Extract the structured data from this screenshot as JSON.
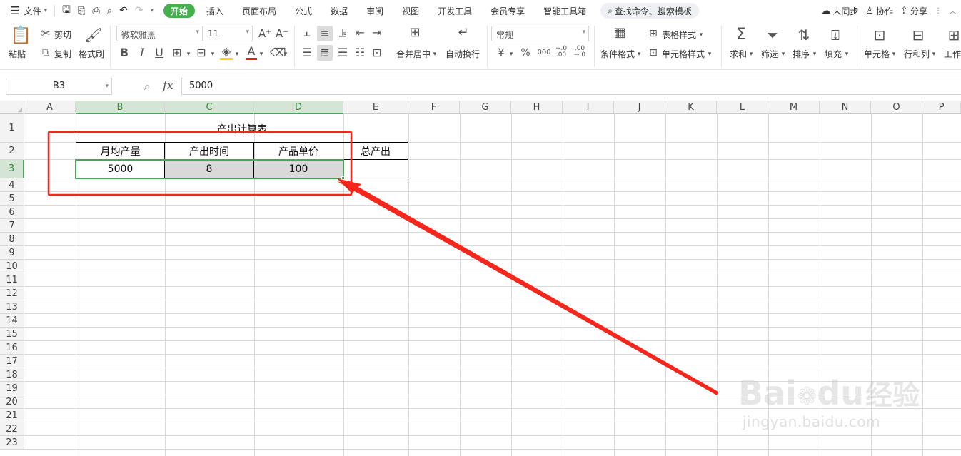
{
  "menu": {
    "file_label": "文件",
    "tabs": [
      "开始",
      "插入",
      "页面布局",
      "公式",
      "数据",
      "审阅",
      "视图",
      "开发工具",
      "会员专享",
      "智能工具箱"
    ],
    "search_label": "查找命令、搜索模板",
    "sync_label": "未同步",
    "collab_label": "协作",
    "share_label": "分享"
  },
  "ribbon": {
    "paste": "粘贴",
    "cut": "剪切",
    "copy": "复制",
    "format_painter": "格式刷",
    "font_name": "微软雅黑",
    "font_size": "11",
    "merge_center": "合并居中",
    "auto_wrap": "自动换行",
    "number_format": "常规",
    "cond_format": "条件格式",
    "table_style": "表格样式",
    "cell_style": "单元格样式",
    "sum": "求和",
    "filter": "筛选",
    "sort": "排序",
    "fill": "填充",
    "cell": "单元格",
    "row_col": "行和列",
    "worksheet": "工作"
  },
  "formula_bar": {
    "cell_ref": "B3",
    "fx_label": "fx",
    "value": "5000"
  },
  "sheet": {
    "columns": [
      "A",
      "B",
      "C",
      "D",
      "E",
      "F",
      "G",
      "H",
      "I",
      "J",
      "K",
      "L",
      "M",
      "N",
      "O",
      "P"
    ],
    "rows": [
      "1",
      "2",
      "3",
      "4",
      "5",
      "6",
      "7",
      "8",
      "9",
      "10",
      "11",
      "12",
      "13",
      "14",
      "15",
      "16",
      "17",
      "18",
      "19",
      "20",
      "21",
      "22",
      "23"
    ],
    "title": "产出计算表",
    "headers": [
      "月均产量",
      "产出时间",
      "产品单价",
      "总产出"
    ],
    "values": [
      "5000",
      "8",
      "100"
    ]
  },
  "watermark": {
    "brand": "Bai",
    "brand2": "du",
    "product": "经验",
    "url": "jingyan.baidu.com"
  },
  "colors": {
    "accent": "#46b04f",
    "annotation": "#f5271d"
  }
}
